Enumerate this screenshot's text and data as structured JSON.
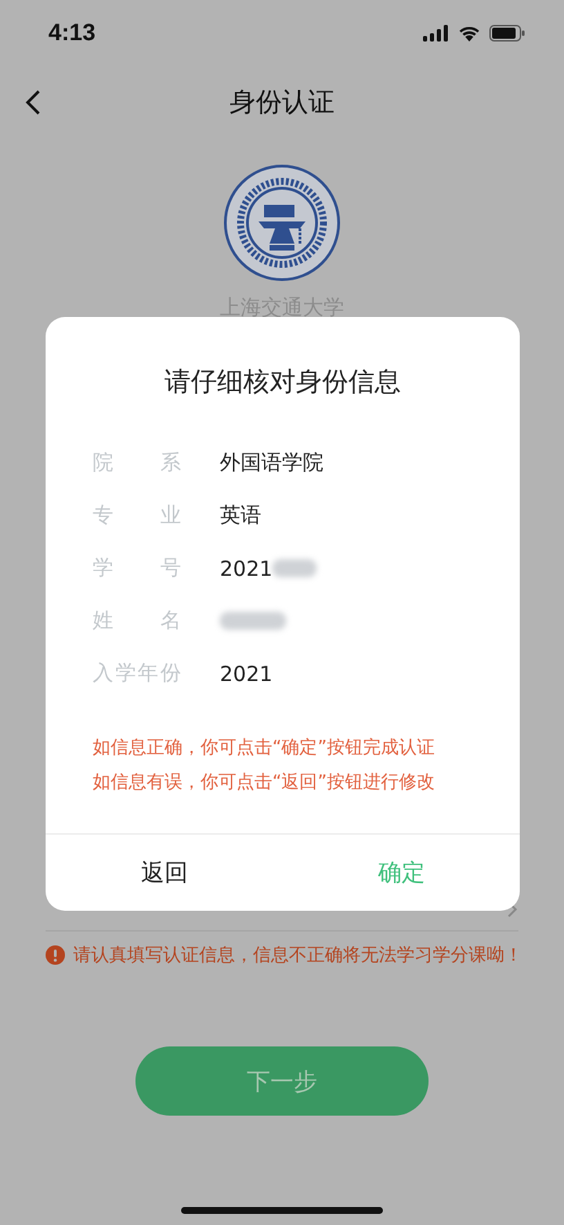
{
  "status_bar": {
    "time": "4:13"
  },
  "header": {
    "title": "身份认证"
  },
  "school": {
    "name": "上海交通大学"
  },
  "warning": "请认真填写认证信息，信息不正确将无法学习学分课呦！",
  "next_button": {
    "label": "下一步",
    "disabled": true
  },
  "dialog": {
    "title": "请仔细核对身份信息",
    "fields": [
      {
        "label": "院 系",
        "value": "外国语学院",
        "redacted": false
      },
      {
        "label": "专 业",
        "value": "英语",
        "redacted": false
      },
      {
        "label": "学 号",
        "value": "2021",
        "redacted": true
      },
      {
        "label": "姓 名",
        "redacted": true
      },
      {
        "label": "入学年份",
        "value": "2021",
        "redacted": false
      }
    ],
    "notes": [
      "如信息正确，你可点击“确定”按钮完成认证",
      "如信息有误，你可点击“返回”按钮进行修改"
    ],
    "buttons": [
      {
        "label": "返回",
        "kind": "cancel"
      },
      {
        "label": "确定",
        "kind": "confirm"
      }
    ]
  }
}
